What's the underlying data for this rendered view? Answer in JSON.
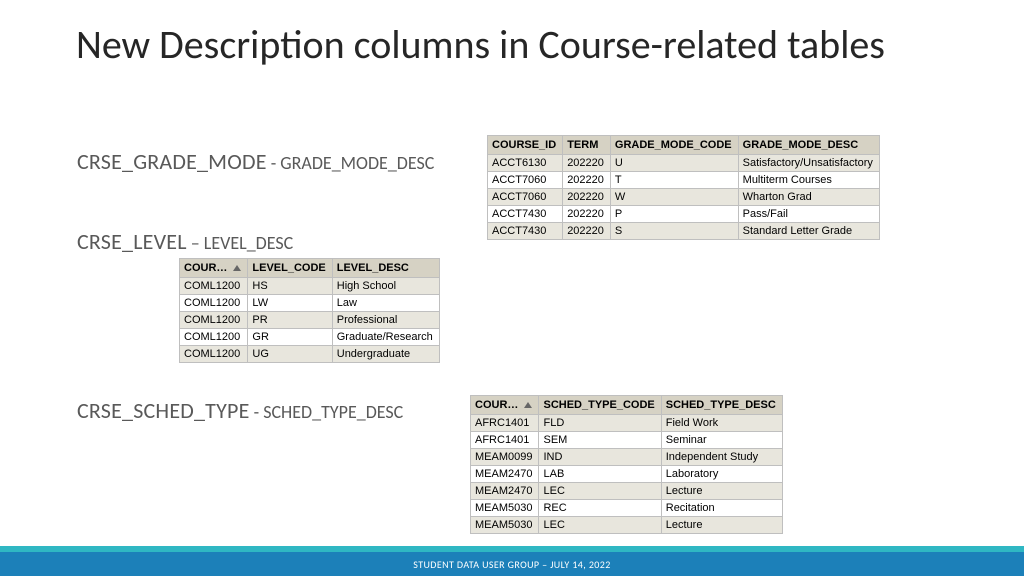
{
  "title": "New Description columns in Course-related tables",
  "sections": {
    "grade": {
      "primary": "CRSE_GRADE_MODE",
      "sep": "  - ",
      "secondary": "GRADE_MODE_DESC"
    },
    "level": {
      "primary": "CRSE_LEVEL",
      "sep": " – ",
      "secondary": "LEVEL_DESC"
    },
    "sched": {
      "primary": "CRSE_SCHED_TYPE",
      "sep": "  - ",
      "secondary": "SCHED_TYPE_DESC"
    }
  },
  "tables": {
    "grade": {
      "headers": [
        "COURSE_ID",
        "TERM",
        "GRADE_MODE_CODE",
        "GRADE_MODE_DESC"
      ],
      "rows": [
        [
          "ACCT6130",
          "202220",
          "U",
          "Satisfactory/Unsatisfactory"
        ],
        [
          "ACCT7060",
          "202220",
          "T",
          "Multiterm Courses"
        ],
        [
          "ACCT7060",
          "202220",
          "W",
          "Wharton Grad"
        ],
        [
          "ACCT7430",
          "202220",
          "P",
          "Pass/Fail"
        ],
        [
          "ACCT7430",
          "202220",
          "S",
          "Standard Letter Grade"
        ]
      ]
    },
    "level": {
      "headers": [
        "COUR…",
        "LEVEL_CODE",
        "LEVEL_DESC"
      ],
      "sort_col": 0,
      "rows": [
        [
          "COML1200",
          "HS",
          "High School"
        ],
        [
          "COML1200",
          "LW",
          "Law"
        ],
        [
          "COML1200",
          "PR",
          "Professional"
        ],
        [
          "COML1200",
          "GR",
          "Graduate/Research"
        ],
        [
          "COML1200",
          "UG",
          "Undergraduate"
        ]
      ]
    },
    "sched": {
      "headers": [
        "COUR…",
        "SCHED_TYPE_CODE",
        "SCHED_TYPE_DESC"
      ],
      "sort_col": 0,
      "rows": [
        [
          "AFRC1401",
          "FLD",
          "Field Work"
        ],
        [
          "AFRC1401",
          "SEM",
          "Seminar"
        ],
        [
          "MEAM0099",
          "IND",
          "Independent Study"
        ],
        [
          "MEAM2470",
          "LAB",
          "Laboratory"
        ],
        [
          "MEAM2470",
          "LEC",
          "Lecture"
        ],
        [
          "MEAM5030",
          "REC",
          "Recitation"
        ],
        [
          "MEAM5030",
          "LEC",
          "Lecture"
        ]
      ]
    }
  },
  "footer": "STUDENT DATA USER GROUP – JULY 14, 2022"
}
